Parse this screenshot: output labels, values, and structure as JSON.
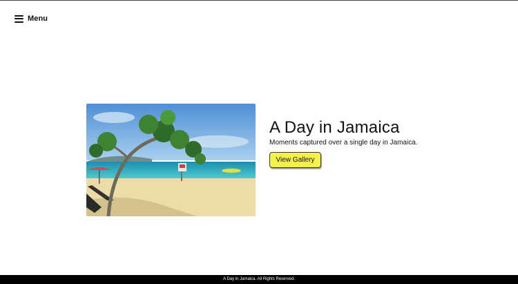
{
  "menu": {
    "label": "Menu",
    "icon": "hamburger-menu-icon"
  },
  "hero": {
    "title": "A Day in Jamaica",
    "subtitle": "Moments captured over a single day in Jamaica.",
    "button_label": "View Gallery",
    "button_color": "#f6f04a"
  },
  "footer": {
    "text": "A Day in Jamaica. All Rights Reserved."
  }
}
